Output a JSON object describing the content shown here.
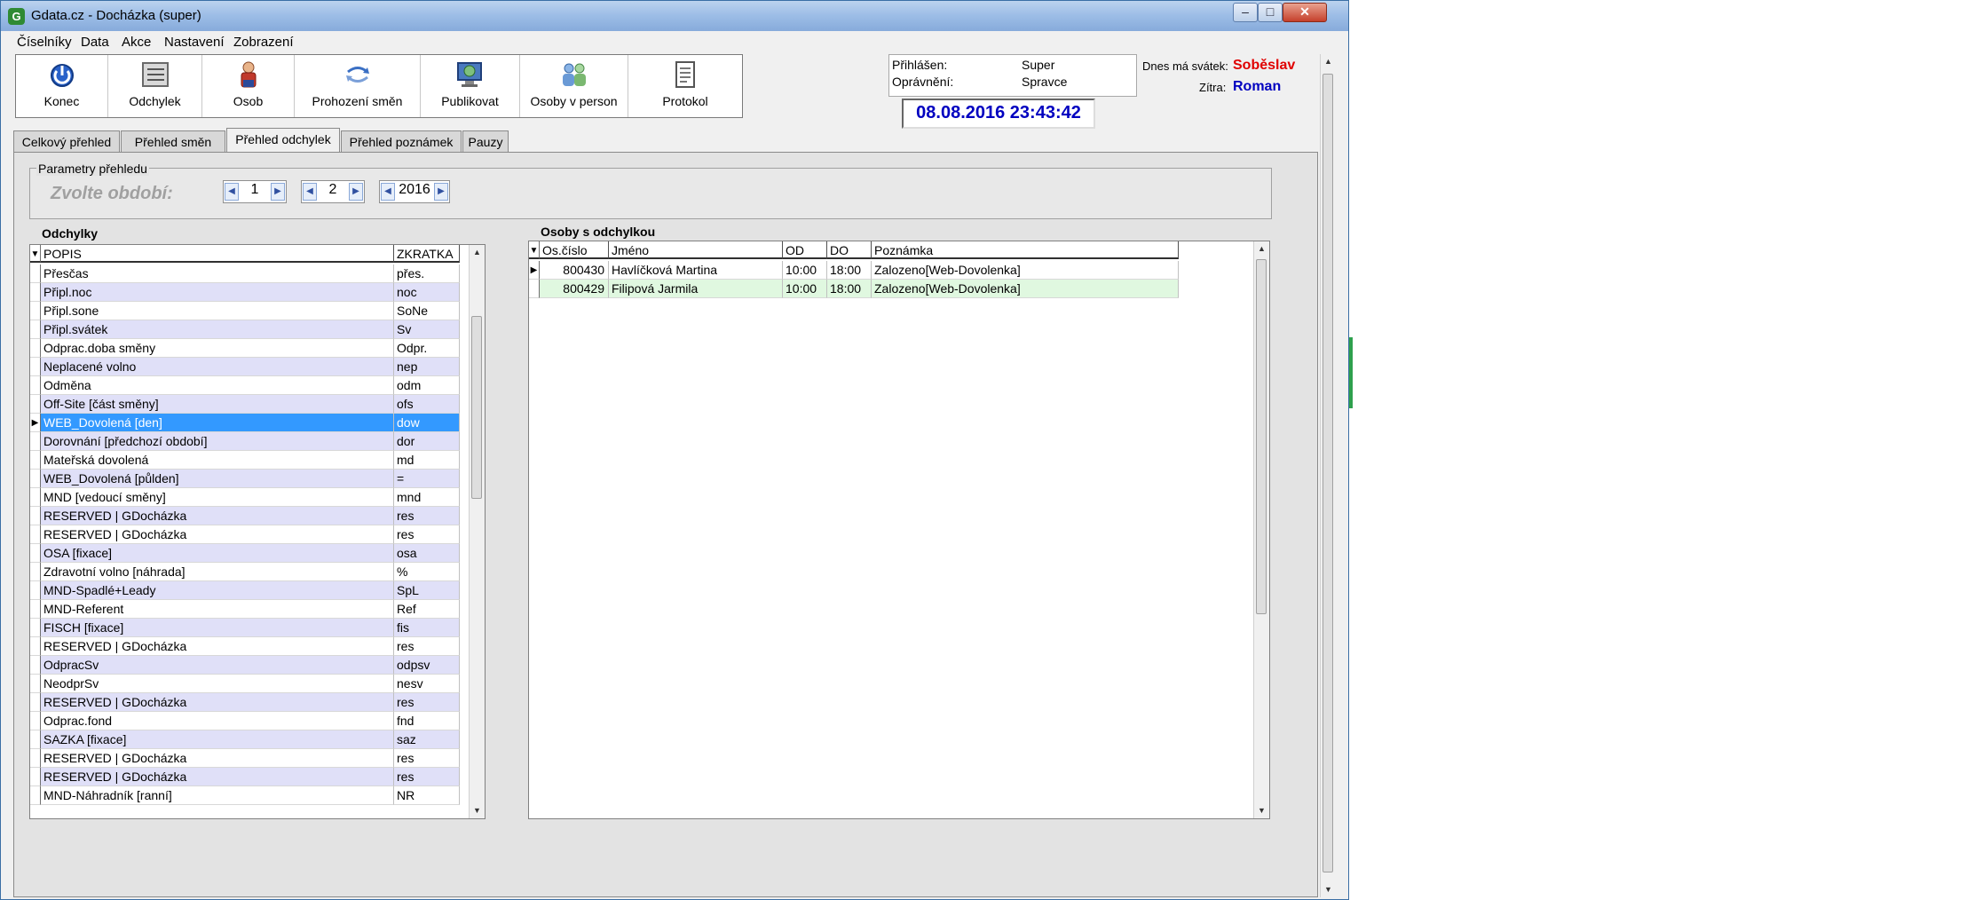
{
  "window": {
    "title": "Gdata.cz - Docházka (super)",
    "icon": "G",
    "min": "–",
    "max": "□",
    "close": "✕"
  },
  "menu": [
    "Číselníky",
    "Data",
    "Akce",
    "Nastavení",
    "Zobrazení"
  ],
  "toolbar": [
    {
      "label": "Konec",
      "icon": "power-icon"
    },
    {
      "label": "Odchylek",
      "icon": "list-icon"
    },
    {
      "label": "Osob",
      "icon": "person-icon"
    },
    {
      "label": "Prohození směn",
      "icon": "swap-icon"
    },
    {
      "label": "Publikovat",
      "icon": "globe-monitor-icon"
    },
    {
      "label": "Osoby v person",
      "icon": "people-icon"
    },
    {
      "label": "Protokol",
      "icon": "document-icon"
    }
  ],
  "login": {
    "logged_label": "Přihlášen:",
    "logged_value": "Super",
    "rights_label": "Oprávnění:",
    "rights_value": "Spravce"
  },
  "datetime": "08.08.2016 23:43:42",
  "nameday": {
    "today_label": "Dnes má svátek:",
    "today_name": "Soběslav",
    "tomorrow_label": "Zítra:",
    "tomorrow_name": "Roman",
    "today_color": "#e00000",
    "tomorrow_color": "#0000c0"
  },
  "tabs": [
    "Celkový přehled",
    "Přehled směn",
    "Přehled odchylek",
    "Přehled poznámek",
    "Pauzy"
  ],
  "active_tab": 2,
  "params": {
    "title": "Parametry přehledu",
    "period_label": "Zvolte období:",
    "spin1": "1",
    "spin2": "2",
    "spin3": "2016"
  },
  "deviations": {
    "title": "Odchylky",
    "headers": [
      "POPIS",
      "ZKRATKA"
    ],
    "selected_index": 8,
    "rows": [
      [
        "Přesčas",
        "přes."
      ],
      [
        "Připl.noc",
        "noc"
      ],
      [
        "Připl.sone",
        "SoNe"
      ],
      [
        "Připl.svátek",
        "Sv"
      ],
      [
        "Odprac.doba směny",
        "Odpr."
      ],
      [
        "Neplacené volno",
        "nep"
      ],
      [
        "Odměna",
        "odm"
      ],
      [
        "Off-Site [část směny]",
        "ofs"
      ],
      [
        "WEB_Dovolená [den]",
        "dow"
      ],
      [
        "Dorovnání [předchozí období]",
        "dor"
      ],
      [
        "Mateřská dovolená",
        "md"
      ],
      [
        "WEB_Dovolená [půlden]",
        "="
      ],
      [
        "MND [vedoucí směny]",
        "mnd"
      ],
      [
        "RESERVED | GDocházka",
        "res"
      ],
      [
        "RESERVED | GDocházka",
        "res"
      ],
      [
        "OSA [fixace]",
        "osa"
      ],
      [
        "Zdravotní volno [náhrada]",
        "%"
      ],
      [
        "MND-Spadlé+Leady",
        "SpL"
      ],
      [
        "MND-Referent",
        "Ref"
      ],
      [
        "FISCH [fixace]",
        "fis"
      ],
      [
        "RESERVED | GDocházka",
        "res"
      ],
      [
        "OdpracSv",
        "odpsv"
      ],
      [
        "NeodprSv",
        "nesv"
      ],
      [
        "RESERVED | GDocházka",
        "res"
      ],
      [
        "Odprac.fond",
        "fnd"
      ],
      [
        "SAZKA [fixace]",
        "saz"
      ],
      [
        "RESERVED | GDocházka",
        "res"
      ],
      [
        "RESERVED | GDocházka",
        "res"
      ],
      [
        "MND-Náhradník [ranní]",
        "NR"
      ]
    ]
  },
  "persons": {
    "title": "Osoby s odchylkou",
    "headers": [
      "Os.číslo",
      "Jméno",
      "OD",
      "DO",
      "Poznámka"
    ],
    "rows": [
      [
        "800430",
        "Havlíčková Martina",
        "10:00",
        "18:00",
        "Zalozeno[Web-Dovolenka]"
      ],
      [
        "800429",
        "Filipová Jarmila",
        "10:00",
        "18:00",
        "Zalozeno[Web-Dovolenka]"
      ]
    ]
  },
  "colors": {
    "row_alt": "#e0e0f8",
    "row_selected": "#3399ff",
    "person_alt": "#e0f8e0"
  }
}
